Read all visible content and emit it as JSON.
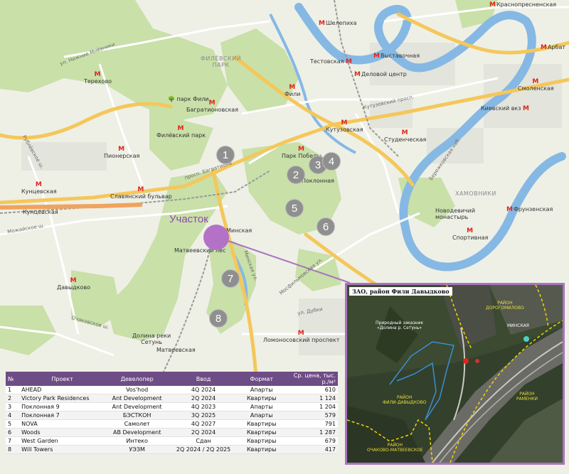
{
  "site_label": "Участок",
  "markers": [
    "1",
    "2",
    "3",
    "4",
    "5",
    "6",
    "7",
    "8"
  ],
  "metro": {
    "shelepikha": "Шелепиха",
    "vystavochnaya": "Выставочная",
    "testovskaya": "Тестовская",
    "delovoy_tsentr": "Деловой центр",
    "terekhovo": "Терехово",
    "bagrationovskaya": "Багратионовская",
    "fili": "Фили",
    "filyovsky_park": "Филёвский парк",
    "pionerskaya": "Пионерская",
    "park_pobedy": "Парк Победы",
    "poklonnaya": "Поклонная",
    "kutuzovskaya": "Кутузовская",
    "studencheskaya": "Студенческая",
    "kievsky": "Киевский вкз",
    "smolenskaya": "Смоленская",
    "kuntsevskaya_top": "Кунцевская",
    "kuntsevskaya": "Кунцевская",
    "slavyansky": "Славянский бульвар",
    "minskaya": "Минская",
    "davydkovo": "Давыдково",
    "frunzenskaya": "Фрунзенская",
    "sportivnaya": "Спортивная",
    "lomonosovsky": "Ломоносовский проспект",
    "matveevskaya": "Матвеевская",
    "krasnopresnenskaya": "Краснопресненская",
    "arbat": "Арбат"
  },
  "places": {
    "filyovsky_park_area": "ФИЛЁВСКИЙ\nПАРК",
    "park_fili": "парк Фили",
    "khamovniki": "ХАМОВНИКИ",
    "novodevichy": "Новодевичий\nмонастырь",
    "matveevsky_les": "Матвеевский лес",
    "dolina_setuni": "Долина реки\nСетунь"
  },
  "roads": {
    "kutuzovsky": "Кутузовский просп.",
    "rublyovskoe": "Рублёвское ш.",
    "mozhayskoe": "Можайское ш.",
    "nizhnie_mnevniki": "ул. Нижние Мнёвники",
    "minskaya_ul": "Минская ул.",
    "mosfilmovskaya": "Мосфильмовская ул.",
    "ul_dubki": "ул. Дубки",
    "ochakovskoe": "Очаковское ш.",
    "berezhkovskaya": "Бережковская наб.",
    "bagrationovsky": "просп. Багратиона"
  },
  "table": {
    "headers": [
      "№",
      "Проект",
      "Девелопер",
      "Ввод",
      "Формат",
      "Ср. цена, тыс. р./м²"
    ],
    "rows": [
      [
        "1",
        "AHEAD",
        "Vos'hod",
        "4Q 2024",
        "Апарты",
        "610"
      ],
      [
        "2",
        "Victory Park Residences",
        "Ant Development",
        "2Q 2024",
        "Квартиры",
        "1 124"
      ],
      [
        "3",
        "Поклонная 9",
        "Ant Development",
        "4Q 2023",
        "Апарты",
        "1 204"
      ],
      [
        "4",
        "Поклонная 7",
        "БЭСТКОН",
        "3Q 2025",
        "Апарты",
        "579"
      ],
      [
        "5",
        "NOVA",
        "Самолет",
        "4Q 2027",
        "Квартиры",
        "791"
      ],
      [
        "6",
        "Woods",
        "AB Development",
        "2Q 2024",
        "Квартиры",
        "1 287"
      ],
      [
        "7",
        "West Garden",
        "Интеко",
        "Сдан",
        "Квартиры",
        "679"
      ],
      [
        "8",
        "Will Towers",
        "УЭЗМ",
        "2Q 2024 / 2Q 2025",
        "Квартиры",
        "417"
      ]
    ]
  },
  "inset": {
    "title": "ЗАО, район Фили Давыдково",
    "labels": {
      "natural": "Природный заказник\n«Долина р. Сетунь»",
      "dorogomilovo": "РАЙОН\nДОРОГОМИЛОВО",
      "minskaya": "МИНСКАЯ",
      "fili_davydkovo": "РАЙОН\nФИЛИ-ДАВЫДКОВО",
      "ramenki": "РАЙОН\nРАМЕНКИ",
      "ochakovo": "РАЙОН\nОЧАКОВО-МАТВЕЕВСКОЕ"
    },
    "route_color": "#3a8ed6",
    "border_color": "#f2d600"
  },
  "colors": {
    "river": "#86b8e4",
    "park": "#c9e0a9",
    "highway": "#f5c75a",
    "marker": "#8f8f8f",
    "site": "#b372c8",
    "table_header": "#6e4c86"
  }
}
